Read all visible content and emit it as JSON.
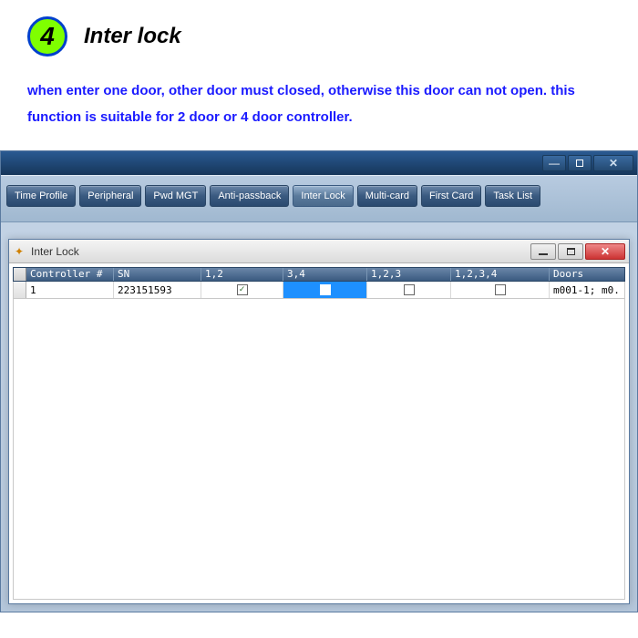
{
  "step": {
    "number": "4",
    "title": "Inter lock"
  },
  "description": "when enter one door, other door must closed, otherwise this door can not open.  this function is suitable for 2 door or 4 door controller.",
  "toolbar": {
    "buttons": [
      "Time Profile",
      "Peripheral",
      "Pwd MGT",
      "Anti-passback",
      "Inter Lock",
      "Multi-card",
      "First Card",
      "Task List"
    ],
    "active_index": 4
  },
  "child_window": {
    "title": "Inter Lock"
  },
  "grid": {
    "headers": [
      "Controller #",
      "SN",
      "1,2",
      "3,4",
      "1,2,3",
      "1,2,3,4",
      "Doors"
    ],
    "row": {
      "controller": "1",
      "sn": "223151593",
      "c12_checked": true,
      "c34_checked": false,
      "c123_checked": false,
      "c1234_checked": false,
      "doors": "m001-1;  m0..."
    }
  }
}
